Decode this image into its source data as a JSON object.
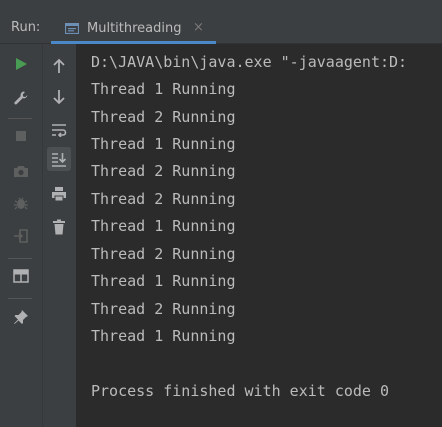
{
  "header": {
    "run_label": "Run:",
    "tab_label": "Multithreading",
    "tab_close": "×"
  },
  "toolbar_left": [
    {
      "name": "rerun-icon"
    },
    {
      "name": "wrench-icon"
    },
    {
      "name": "stop-icon"
    },
    {
      "name": "camera-icon"
    },
    {
      "name": "bug-icon"
    },
    {
      "name": "exit-icon"
    },
    {
      "name": "layout-icon"
    },
    {
      "name": "pin-icon"
    }
  ],
  "toolbar_right": [
    {
      "name": "up-arrow-icon"
    },
    {
      "name": "down-arrow-icon"
    },
    {
      "name": "soft-wrap-icon"
    },
    {
      "name": "scroll-to-end-icon"
    },
    {
      "name": "print-icon"
    },
    {
      "name": "trash-icon"
    }
  ],
  "console": {
    "lines": [
      "D:\\JAVA\\bin\\java.exe \"-javaagent:D:",
      "Thread 1 Running",
      "Thread 2 Running",
      "Thread 1 Running",
      "Thread 2 Running",
      "Thread 2 Running",
      "Thread 1 Running",
      "Thread 2 Running",
      "Thread 1 Running",
      "Thread 2 Running",
      "Thread 1 Running",
      "",
      "Process finished with exit code 0"
    ]
  },
  "colors": {
    "panel_bg": "#3c3f41",
    "console_bg": "#2b2b2b",
    "text": "#bbbbbb",
    "run_green": "#499c54",
    "tab_underline": "#4a88c7",
    "icon_gray": "#afb1b3",
    "icon_disabled": "#5e6060"
  }
}
